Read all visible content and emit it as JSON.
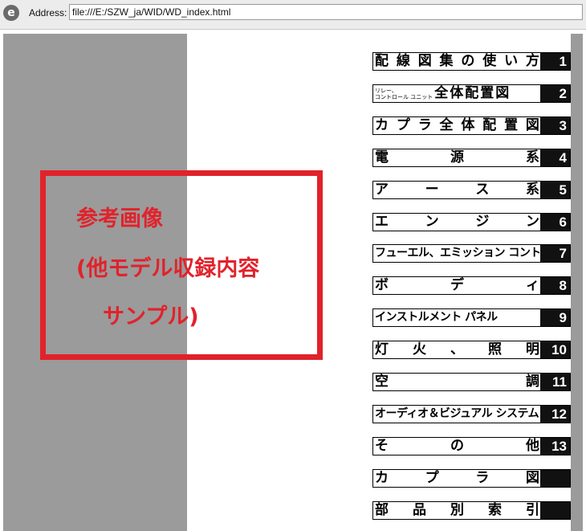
{
  "address_bar": {
    "label": "Address:",
    "url": "file:///E:/SZW_ja/WID/WD_index.html",
    "browser_icon": "e"
  },
  "sample_notice": {
    "line1": "参考画像",
    "line2": "(他モデル収録内容",
    "line3": "サンプル)"
  },
  "index_items": [
    {
      "label": "配線図集の使い方",
      "number": "1"
    },
    {
      "small_lines": [
        "リレー、",
        "コントロール ユニット"
      ],
      "label": "全体配置図",
      "number": "2"
    },
    {
      "label": "カプラ全体配置図",
      "number": "3"
    },
    {
      "label": "電源系",
      "number": "4"
    },
    {
      "label": "アース系",
      "number": "5"
    },
    {
      "label": "エンジン",
      "number": "6"
    },
    {
      "label": "フューエル、エミッション コントロール",
      "number": "7"
    },
    {
      "label": "ボディ",
      "number": "8"
    },
    {
      "label": "インストルメント パネル",
      "number": "9"
    },
    {
      "label": "灯火、照明",
      "number": "10"
    },
    {
      "label": "空調",
      "number": "11"
    },
    {
      "label": "オーディオ＆ビジュアル システム",
      "number": "12"
    },
    {
      "label": "その他",
      "number": "13"
    },
    {
      "label": "カプラ図",
      "number": ""
    },
    {
      "label": "部品別索引",
      "number": ""
    }
  ]
}
